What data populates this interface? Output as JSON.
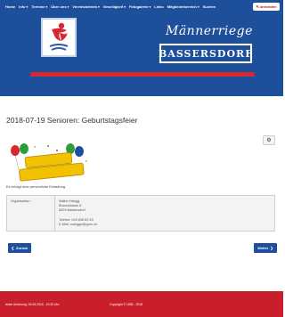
{
  "nav": {
    "items": [
      {
        "label": "Home",
        "caret": ""
      },
      {
        "label": "Info",
        "caret": "▾"
      },
      {
        "label": "Termine",
        "caret": "▾"
      },
      {
        "label": "Über uns",
        "caret": "▾"
      },
      {
        "label": "Vereinsbetrieb",
        "caret": "▾"
      },
      {
        "label": "Geselligkeit",
        "caret": "▾"
      },
      {
        "label": "Fotogalerie",
        "caret": "▾"
      },
      {
        "label": "Links",
        "caret": ""
      },
      {
        "label": "Mitgliederbereich",
        "caret": "▾"
      },
      {
        "label": "Suchen",
        "caret": ""
      }
    ],
    "login_label": "anmelden"
  },
  "brand": {
    "script": "Männerriege",
    "box": "BASSERSDORF"
  },
  "content": {
    "title": "2018-07-19 Senioren: Geburtstagsfeier",
    "gear_icon": "⚙",
    "invite": "Es erfolgt eine persönliche Einladung.",
    "organizer_label": "Organisation:",
    "organizer": {
      "name": "Walter Haegg",
      "street": "Branzstrasse 8",
      "city": "8303 Bassersdorf",
      "phone": "Telefon: 044 836 82 53",
      "email": "E-Mail: waeggw@gmx.ch"
    }
  },
  "buttons": {
    "back_label": "Zurück",
    "next_label": "Weiter"
  },
  "footer": {
    "last_change": "letzte Änderung: 15.06.2018 - 10:30 Uhr",
    "copyright": "Copyright © 1835 - 2018"
  },
  "colors": {
    "primary": "#1d4f9a",
    "accent": "#d7282f"
  }
}
